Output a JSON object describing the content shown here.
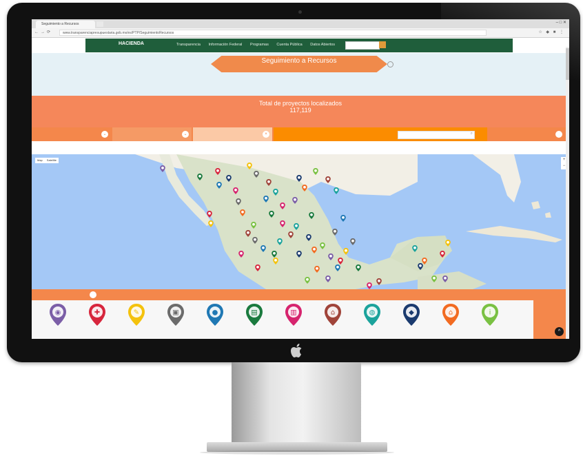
{
  "browser": {
    "tab_title": "Seguimiento a Recursos",
    "url": "www.transparenciapresupuestaria.gob.mx/es/PTP/SeguimientoRecursos",
    "window_controls": "–  □  ✕"
  },
  "site_nav": {
    "brand": "HACIENDA",
    "links": [
      "Transparencia",
      "Información Federal",
      "Programas",
      "Cuenta Pública",
      "Datos Abiertos"
    ]
  },
  "hero": {
    "title": "Seguimiento a Recursos",
    "subtitle": "",
    "intro_lines": [
      "",
      "",
      ""
    ]
  },
  "counter": {
    "label": "Total de proyectos localizados",
    "value": "117,119",
    "caption": ""
  },
  "filters": {
    "items": [
      "",
      "",
      ""
    ],
    "search_label_1": "",
    "search_label_2": "",
    "right_label": ""
  },
  "map": {
    "toggle": [
      "Map",
      "Satellite"
    ],
    "zoom_in": "+",
    "zoom_out": "−",
    "credit": ""
  },
  "legend_strip": [
    "",
    "",
    "",
    "",
    "",
    ""
  ],
  "categories": [
    {
      "icon": "target-icon",
      "color": "#7b5ea7",
      "label": ""
    },
    {
      "icon": "health-icon",
      "color": "#d7263d",
      "label": ""
    },
    {
      "icon": "feather-icon",
      "color": "#f4c20d",
      "label": ""
    },
    {
      "icon": "truck-icon",
      "color": "#6b6b6b",
      "label": ""
    },
    {
      "icon": "drop-icon",
      "color": "#1f78b4",
      "label": ""
    },
    {
      "icon": "book-icon",
      "color": "#1a7a3e",
      "label": ""
    },
    {
      "icon": "building-icon",
      "color": "#d6246e",
      "label": ""
    },
    {
      "icon": "factory-icon",
      "color": "#a0443a",
      "label": ""
    },
    {
      "icon": "globe-icon",
      "color": "#1ba39c",
      "label": ""
    },
    {
      "icon": "shield-icon",
      "color": "#1b3b6f",
      "label": ""
    },
    {
      "icon": "house-icon",
      "color": "#f26b21",
      "label": ""
    },
    {
      "icon": "info-icon",
      "color": "#7ac143",
      "label": ""
    }
  ],
  "side_box": {
    "line1": "",
    "line2": "",
    "line3": ""
  },
  "fab_glyph": "^"
}
